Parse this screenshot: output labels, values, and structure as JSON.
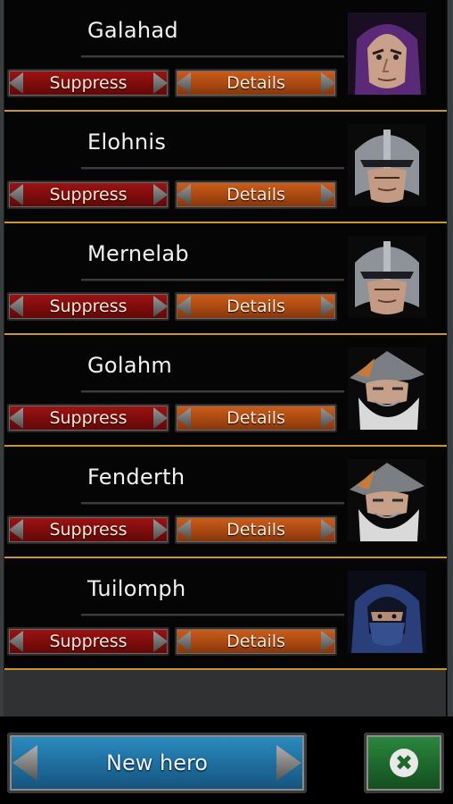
{
  "heroes": [
    {
      "name": "Galahad",
      "portrait": "hooded-mage-purple-portrait"
    },
    {
      "name": "Elohnis",
      "portrait": "helmeted-knight-portrait"
    },
    {
      "name": "Mernelab",
      "portrait": "helmeted-knight-portrait"
    },
    {
      "name": "Golahm",
      "portrait": "bearded-wizard-portrait"
    },
    {
      "name": "Fenderth",
      "portrait": "bearded-wizard-portrait"
    },
    {
      "name": "Tuilomph",
      "portrait": "blue-hooded-rogue-portrait"
    }
  ],
  "buttons": {
    "suppress_label": "Suppress",
    "details_label": "Details",
    "new_hero_label": "New hero",
    "close_icon": "close-icon"
  },
  "colors": {
    "separator": "#c9962f",
    "suppress": "#8b0f0f",
    "details": "#c0551a",
    "new_hero": "#1f6fa0",
    "close": "#1e6a2d"
  }
}
